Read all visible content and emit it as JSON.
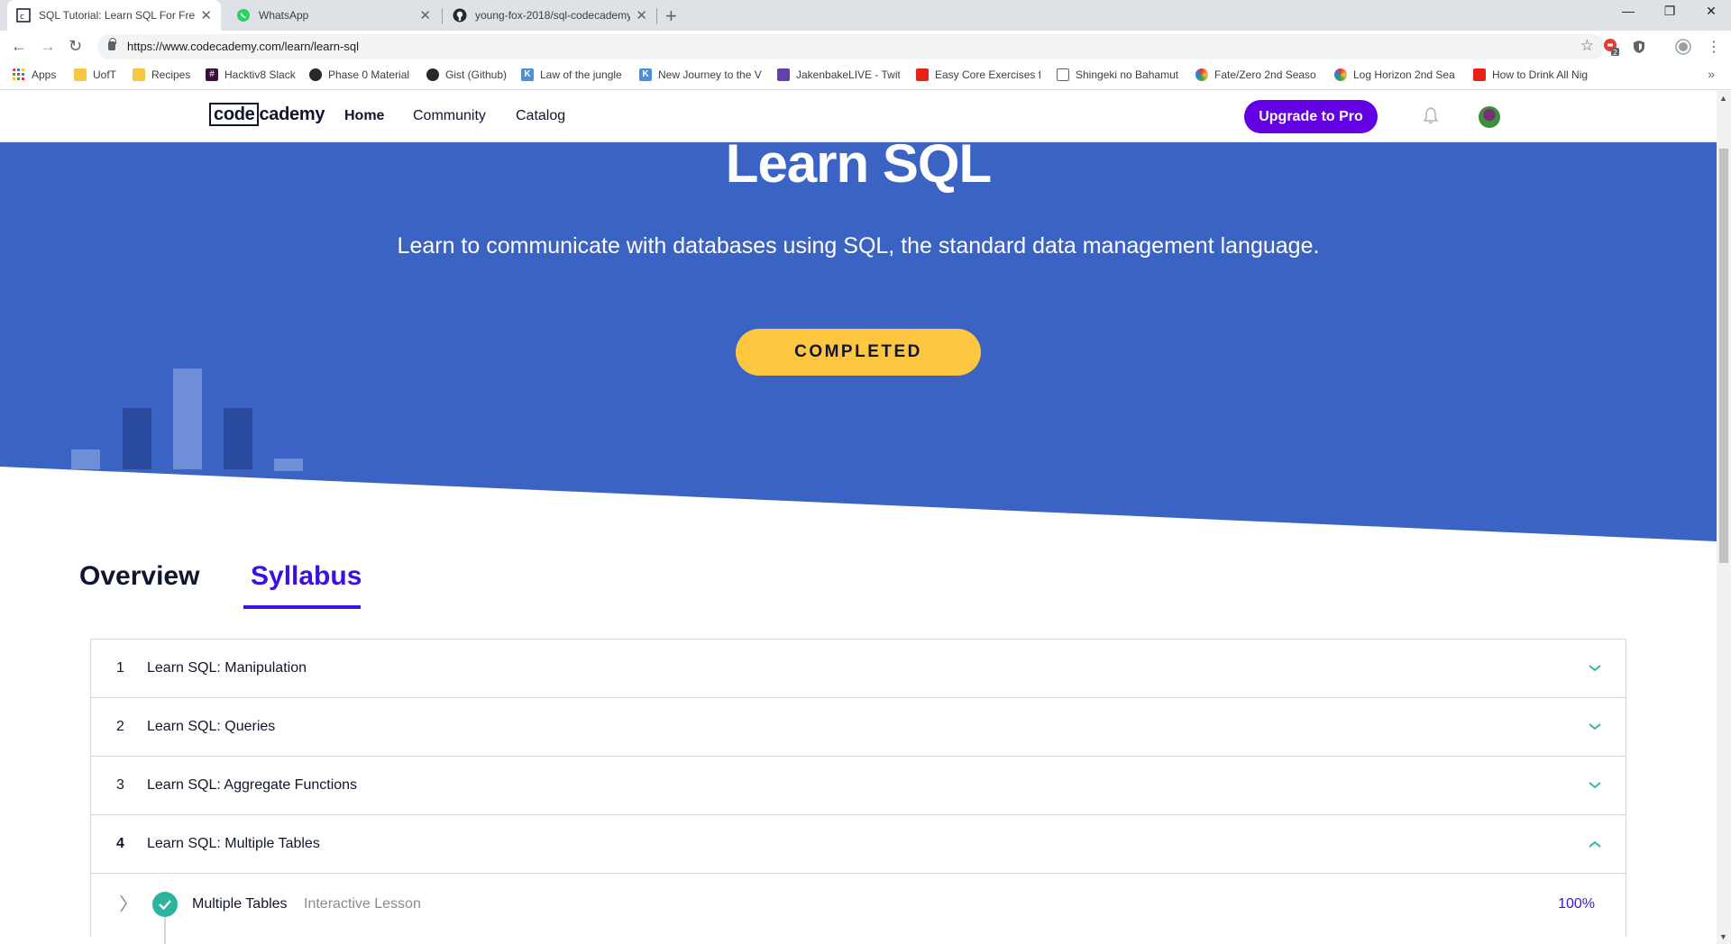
{
  "browser": {
    "tabs": [
      {
        "title": "SQL Tutorial: Learn SQL For Free",
        "active": true,
        "icon": "codecademy-favicon"
      },
      {
        "title": "WhatsApp",
        "active": false,
        "icon": "whatsapp-icon"
      },
      {
        "title": "young-fox-2018/sql-codecademy",
        "active": false,
        "icon": "github-icon"
      }
    ],
    "url": "https://www.codecademy.com/learn/learn-sql",
    "extension_badge": "2",
    "bookmarks": [
      {
        "label": "Apps",
        "icon": "apps-grid-icon"
      },
      {
        "label": "UofT",
        "icon": "folder-icon"
      },
      {
        "label": "Recipes",
        "icon": "folder-icon"
      },
      {
        "label": "Hacktiv8 Slack",
        "icon": "slack-icon"
      },
      {
        "label": "Phase 0 Material",
        "icon": "github-icon"
      },
      {
        "label": "Gist (Github)",
        "icon": "github-icon"
      },
      {
        "label": "Law of the jungle",
        "icon": "k-icon"
      },
      {
        "label": "New Journey to the V",
        "icon": "k-icon"
      },
      {
        "label": "JakenbakeLIVE - Twit",
        "icon": "twitch-icon"
      },
      {
        "label": "Easy Core Exercises f",
        "icon": "youtube-icon"
      },
      {
        "label": "Shingeki no Bahamut",
        "icon": "page-icon"
      },
      {
        "label": "Fate/Zero 2nd Seaso",
        "icon": "crunchyroll-icon"
      },
      {
        "label": "Log Horizon 2nd Sea",
        "icon": "crunchyroll-icon"
      },
      {
        "label": "How to Drink All Nig",
        "icon": "youtube-icon"
      }
    ]
  },
  "site": {
    "logo_left": "code",
    "logo_right": "cademy",
    "nav": {
      "home": "Home",
      "community": "Community",
      "catalog": "Catalog"
    },
    "upgrade_label": "Upgrade to Pro"
  },
  "hero": {
    "title": "Learn SQL",
    "subtitle": "Learn to communicate with databases using SQL, the standard data management language.",
    "status_label": "COMPLETED",
    "background_color": "#3b63c3",
    "accent_color": "#ffc740"
  },
  "page_tabs": {
    "overview": "Overview",
    "syllabus": "Syllabus"
  },
  "syllabus": {
    "units": [
      {
        "number": "1",
        "label": "Learn SQL: Manipulation",
        "expanded": false
      },
      {
        "number": "2",
        "label": "Learn SQL: Queries",
        "expanded": false
      },
      {
        "number": "3",
        "label": "Learn SQL: Aggregate Functions",
        "expanded": false
      },
      {
        "number": "4",
        "label": "Learn SQL: Multiple Tables",
        "expanded": true
      }
    ],
    "lesson": {
      "name": "Multiple Tables",
      "type": "Interactive Lesson",
      "progress": "100%"
    }
  }
}
